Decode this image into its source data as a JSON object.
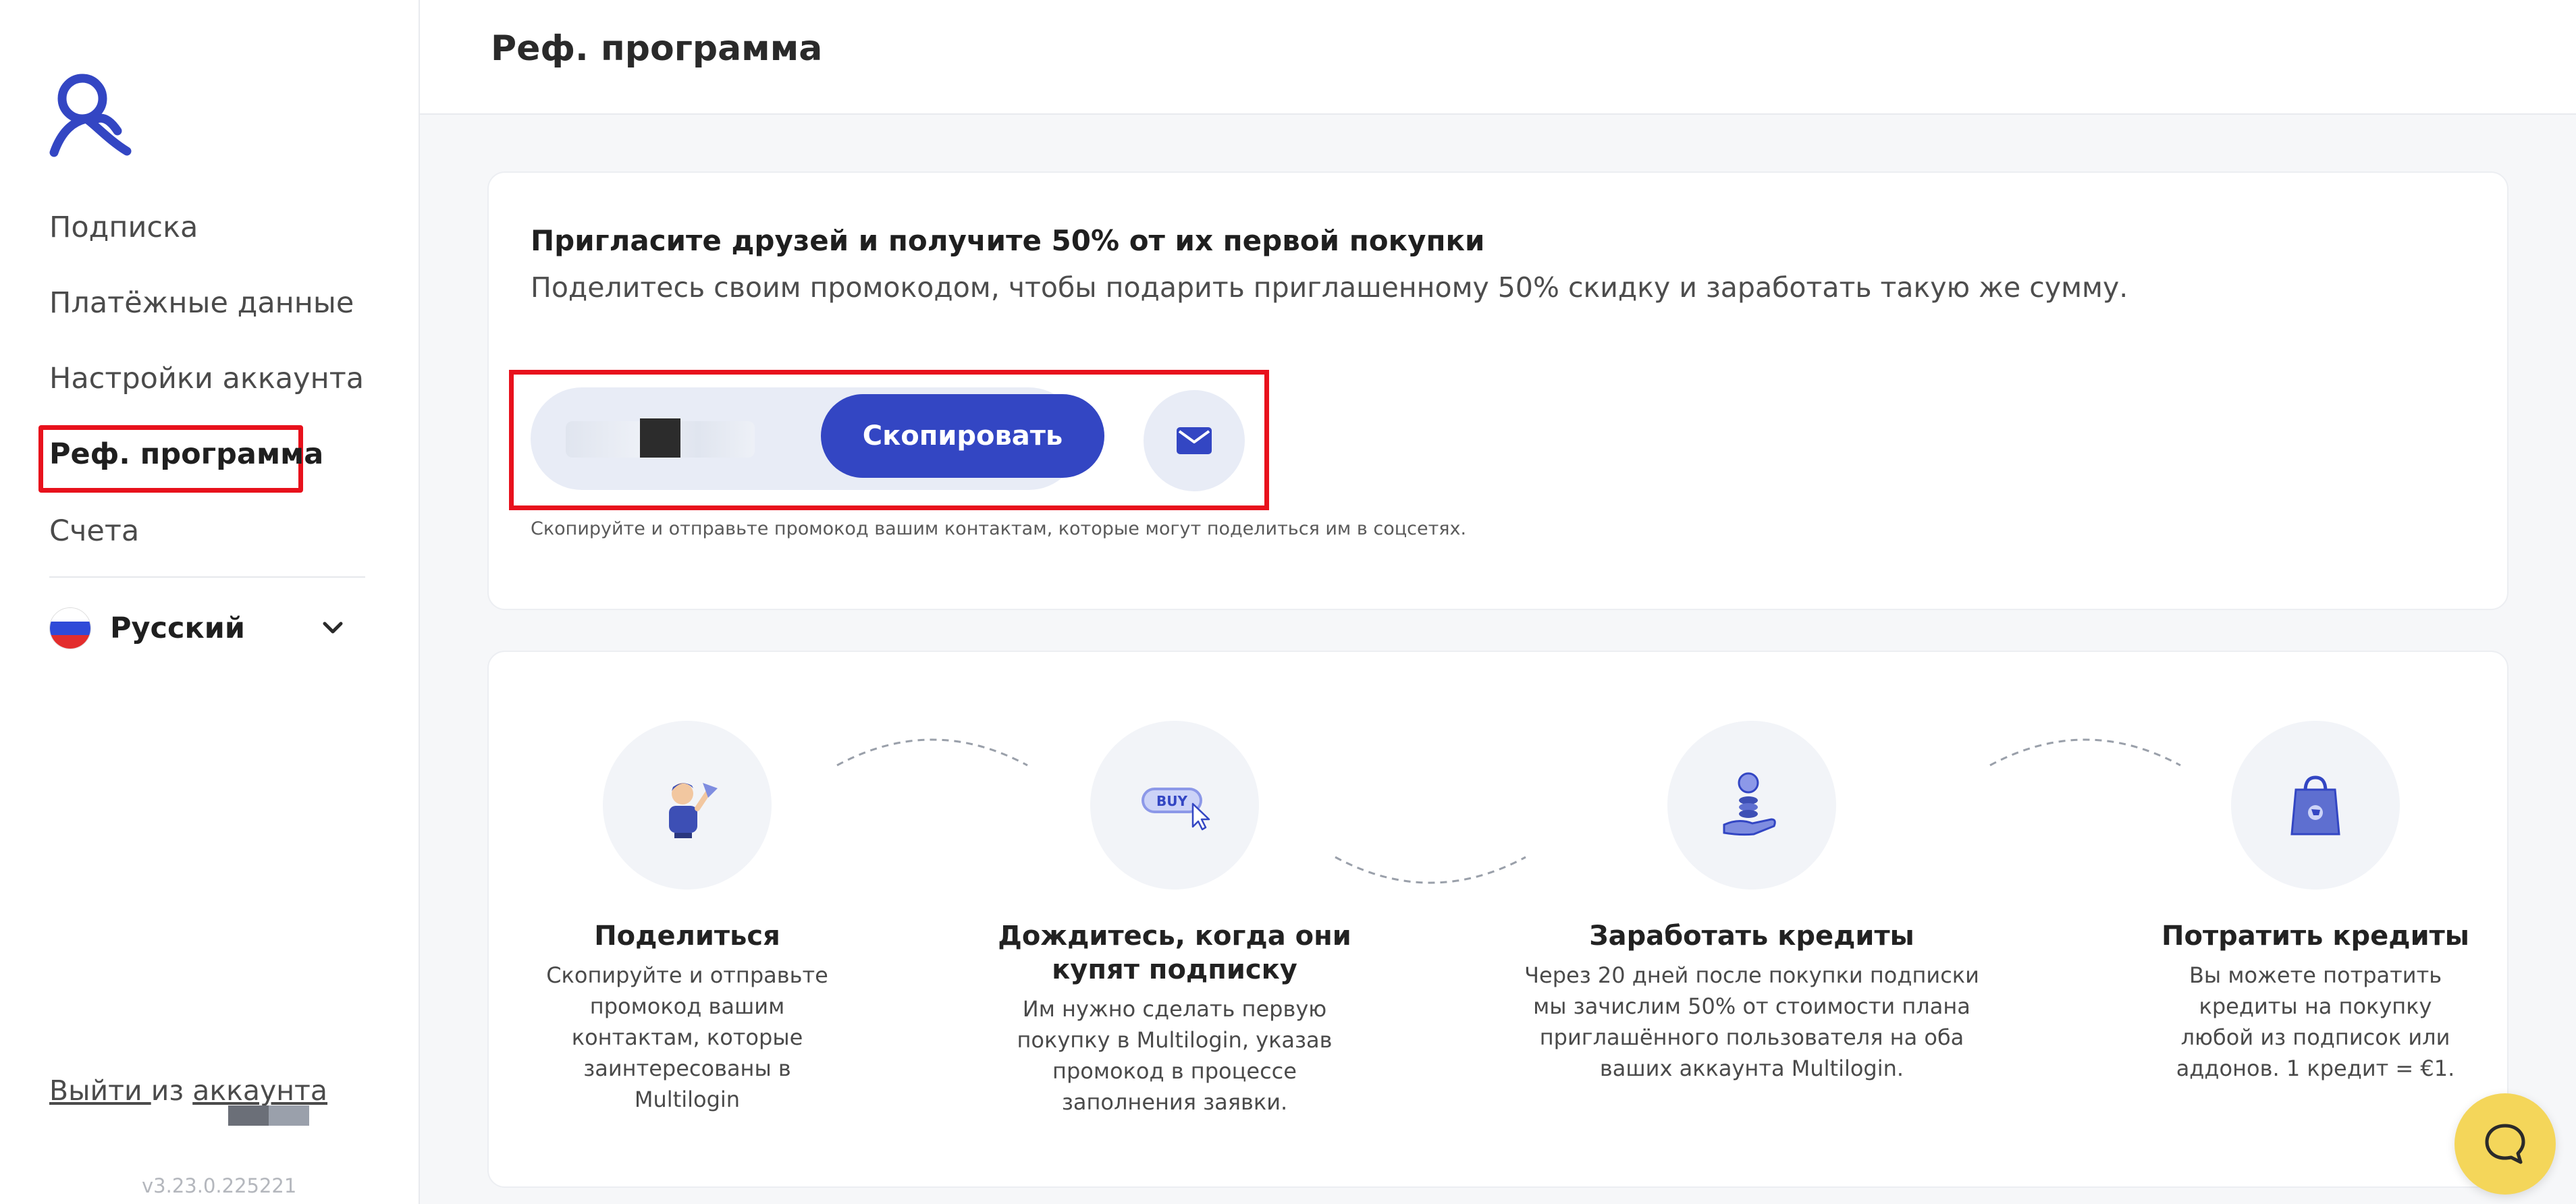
{
  "sidebar": {
    "items": [
      {
        "label": "Подписка"
      },
      {
        "label": "Платёжные данные"
      },
      {
        "label": "Настройки аккаунта"
      },
      {
        "label": "Реф. программа"
      },
      {
        "label": "Счета"
      }
    ],
    "language": "Русский",
    "logout_link1": "Выйти ",
    "logout_mid": "из ",
    "logout_link2": "аккаунта",
    "version": "v3.23.0.225221"
  },
  "header": {
    "title": "Реф. программа"
  },
  "invite": {
    "title": "Пригласите друзей и получите 50% от их первой покупки",
    "subtitle": "Поделитесь своим промокодом, чтобы подарить приглашенному 50% скидку и заработать такую же сумму.",
    "copy_label": "Скопировать",
    "hint": "Скопируйте и отправьте промокод вашим контактам, которые могут поделиться им в соцсетях."
  },
  "steps": [
    {
      "title": "Поделиться",
      "desc": "Скопируйте и отправьте промокод вашим контактам, которые заинтересованы в Multilogin",
      "icon": "share-person-icon"
    },
    {
      "title": "Дождитесь, когда они купят подписку",
      "desc": "Им нужно сделать первую покупку в Multilogin, указав промокод в процессе заполнения заявки.",
      "icon": "buy-cursor-icon",
      "badge": "BUY"
    },
    {
      "title": "Заработать кредиты",
      "desc": "Через 20 дней после покупки подписки мы зачислим 50% от стоимости плана приглашённого пользователя на оба ваших аккаунта Multilogin.",
      "icon": "coins-hand-icon"
    },
    {
      "title": "Потратить кредиты",
      "desc": "Вы можете потратить кредиты на покупку любой из подписок или аддонов. 1 кредит = €1.",
      "icon": "shopping-bag-icon"
    }
  ],
  "colors": {
    "accent": "#3346c3",
    "highlight": "#e8111c",
    "chat": "#f4d65a"
  }
}
